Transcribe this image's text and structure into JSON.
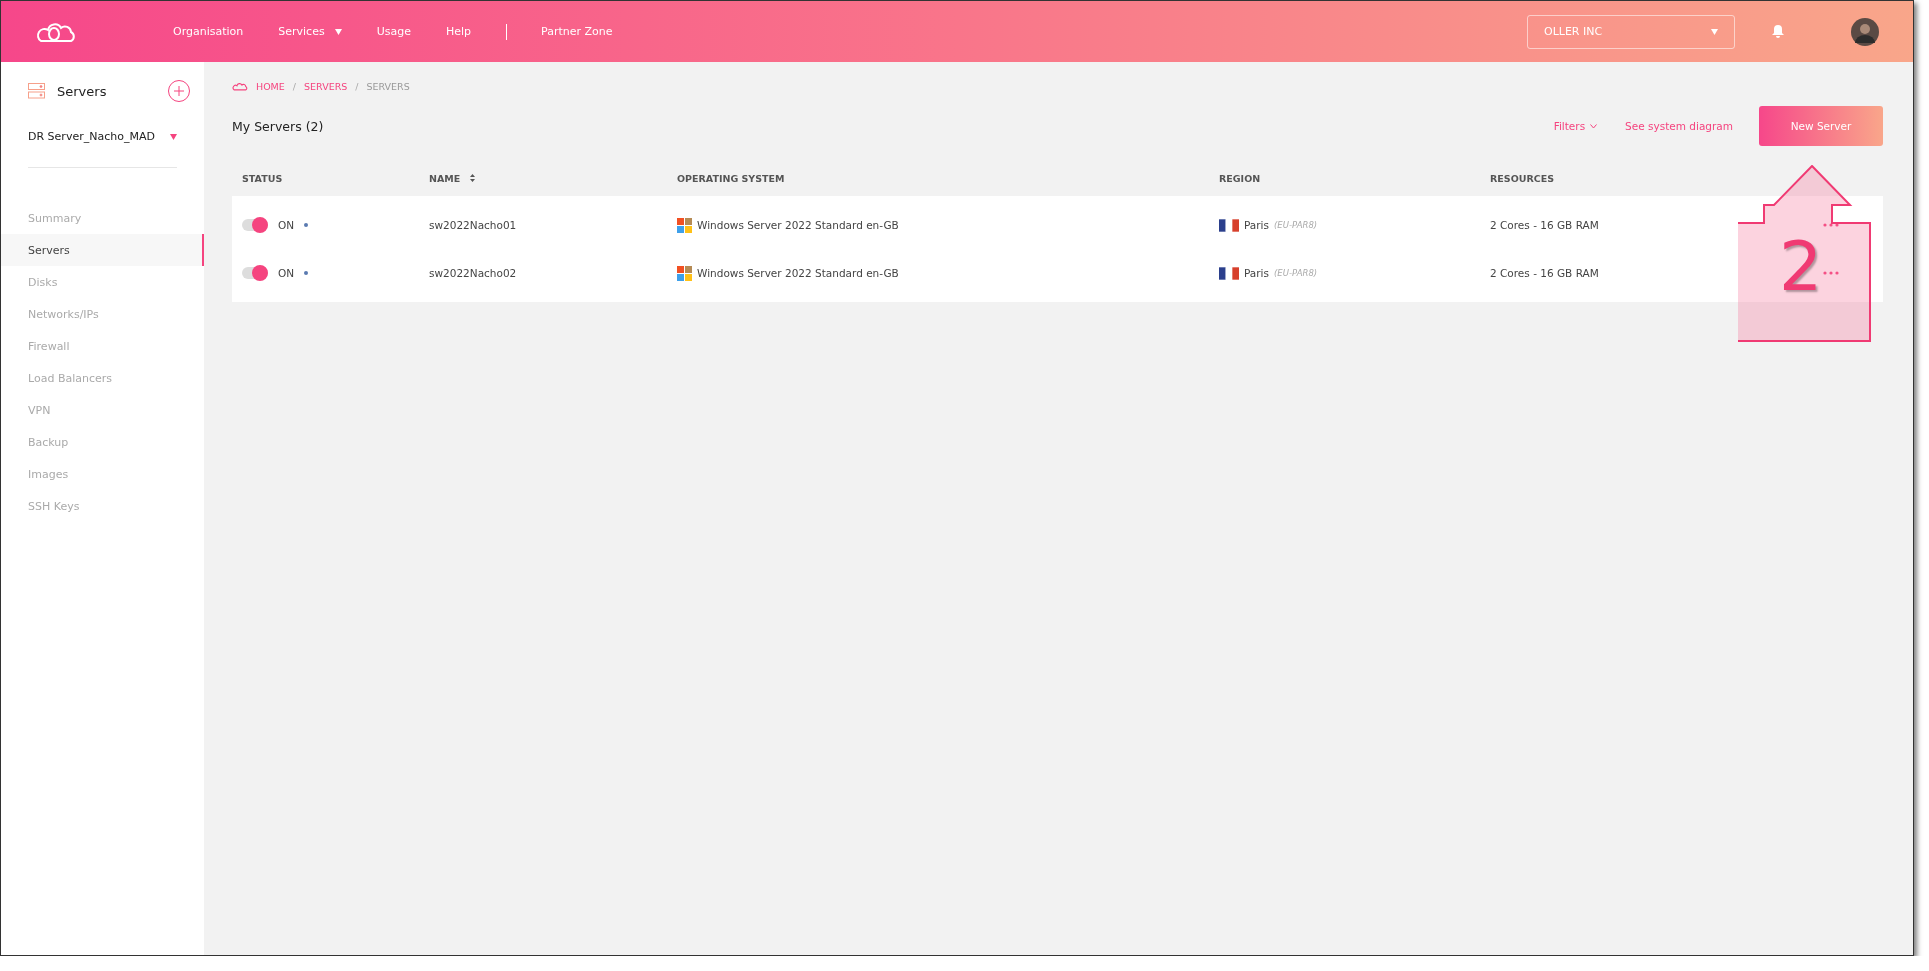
{
  "header": {
    "nav": [
      {
        "label": "Organisation",
        "kind": "link"
      },
      {
        "label": "Services",
        "kind": "dropdown"
      },
      {
        "label": "Usage",
        "kind": "link"
      },
      {
        "label": "Help",
        "kind": "link"
      },
      {
        "kind": "divider"
      },
      {
        "label": "Partner Zone",
        "kind": "link"
      }
    ],
    "organisation": "OLLER INC"
  },
  "sidebar": {
    "title": "Servers",
    "project": "DR Server_Nacho_MAD",
    "items": [
      {
        "label": "Summary",
        "selected": false
      },
      {
        "label": "Servers",
        "selected": true
      },
      {
        "label": "Disks",
        "selected": false
      },
      {
        "label": "Networks/IPs",
        "selected": false
      },
      {
        "label": "Firewall",
        "selected": false
      },
      {
        "label": "Load Balancers",
        "selected": false
      },
      {
        "label": "VPN",
        "selected": false
      },
      {
        "label": "Backup",
        "selected": false
      },
      {
        "label": "Images",
        "selected": false
      },
      {
        "label": "SSH Keys",
        "selected": false
      }
    ]
  },
  "breadcrumb": [
    {
      "label": "HOME",
      "kind": "link"
    },
    {
      "separator": "/",
      "label": "SERVERS",
      "kind": "link"
    },
    {
      "separator": "/",
      "label": "SERVERS",
      "kind": "current"
    }
  ],
  "title": "My Servers (2)",
  "actions": {
    "filters": "Filters",
    "diagram": "See system diagram",
    "new_button": "New Server"
  },
  "table": {
    "columns": [
      {
        "label": "STATUS",
        "sortable": false
      },
      {
        "label": "NAME",
        "sortable": true
      },
      {
        "label": "OPERATING SYSTEM",
        "sortable": false
      },
      {
        "label": "REGION",
        "sortable": false
      },
      {
        "label": "RESOURCES",
        "sortable": false
      }
    ],
    "rows": [
      {
        "on": true,
        "status": "ON",
        "name": "sw2022Nacho01",
        "os": "Windows Server 2022 Standard en-GB",
        "city": "Paris",
        "region_code": "(EU-PAR8)",
        "resources": "2 Cores - 16 GB RAM"
      },
      {
        "on": true,
        "status": "ON",
        "name": "sw2022Nacho02",
        "os": "Windows Server 2022 Standard en-GB",
        "city": "Paris",
        "region_code": "(EU-PAR8)",
        "resources": "2 Cores - 16 GB RAM"
      }
    ]
  },
  "annotation": {
    "number": "2"
  }
}
